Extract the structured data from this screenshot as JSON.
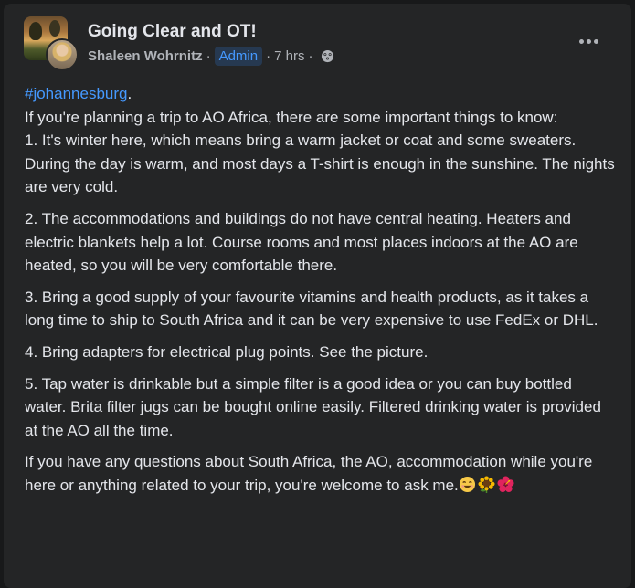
{
  "post": {
    "group_name": "Going Clear and OT!",
    "author": "Shaleen Wohrnitz",
    "role_badge": "Admin",
    "timestamp": "7 hrs",
    "separator": "·",
    "audience_icon": "globe-icon",
    "more_icon": "more-options-icon",
    "hashtag": "#johannesburg",
    "hashtag_suffix": ".",
    "paragraphs": [
      "If you're planning a trip to AO Africa, there are some important things to know:",
      "1. It's winter here, which means bring a warm jacket or coat and some sweaters. During the day is warm, and most days a T-shirt is enough in the sunshine. The nights are very cold.",
      "2. The accommodations and buildings do not have central heating. Heaters and electric blankets help a lot. Course rooms and most places indoors at the AO are heated, so you will be very comfortable there.",
      "3. Bring a good supply of your favourite vitamins and health products, as it takes a long time to ship to South Africa and it can be very expensive to use FedEx or DHL.",
      "4. Bring adapters for electrical plug points. See the picture.",
      "5. Tap water is drinkable but a simple filter is a good idea or you can buy bottled water. Brita filter jugs can be bought online easily. Filtered drinking water is provided at the AO all the time.",
      "If you have any questions about South Africa, the AO, accommodation while you're here or anything related to your trip, you're welcome to ask me."
    ],
    "emojis": [
      "smiling-face-emoji",
      "sunflower-emoji",
      "hibiscus-emoji"
    ]
  },
  "colors": {
    "background": "#18191a",
    "card": "#242526",
    "text": "#e4e6eb",
    "secondary_text": "#b0b3b8",
    "link": "#4599ff",
    "badge_bg": "#263951"
  }
}
